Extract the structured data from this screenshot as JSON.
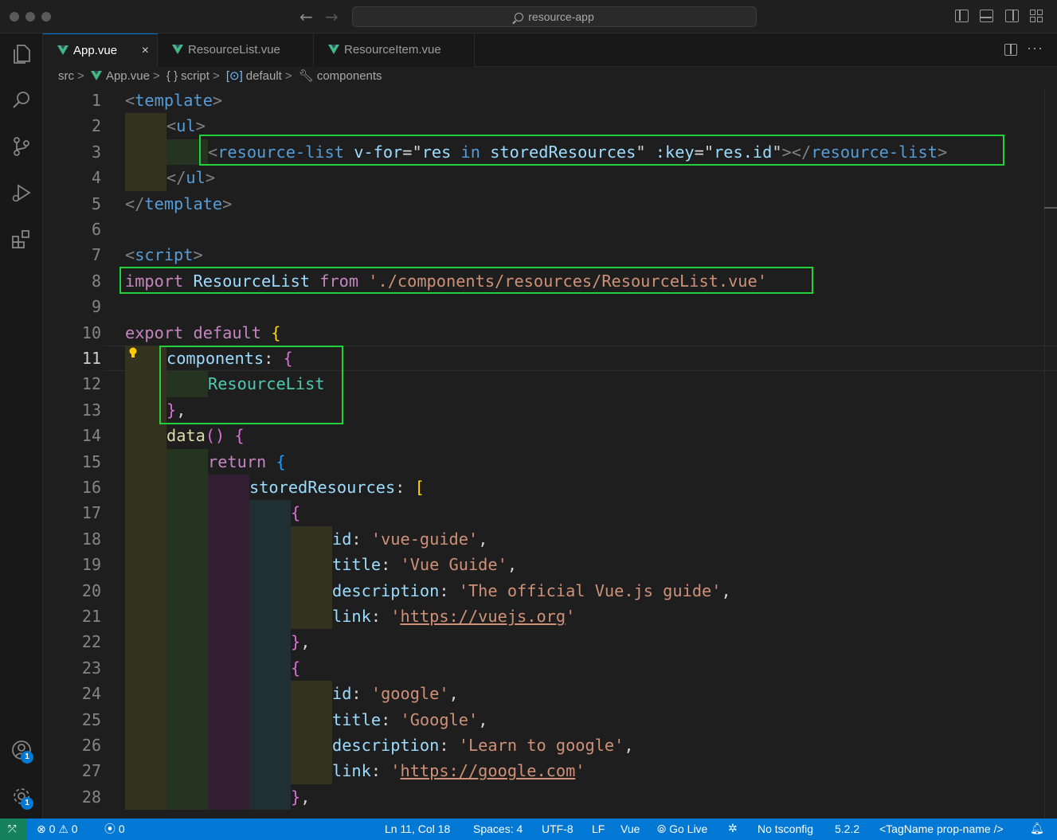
{
  "window": {
    "search_text": "resource-app"
  },
  "tabs": [
    {
      "label": "App.vue",
      "active": true,
      "icon": "vue-icon"
    },
    {
      "label": "ResourceList.vue",
      "active": false,
      "icon": "vue-icon"
    },
    {
      "label": "ResourceItem.vue",
      "active": false,
      "icon": "vue-icon"
    }
  ],
  "tab_close_glyph": "×",
  "more_glyph": "···",
  "breadcrumb": {
    "src": "src",
    "file": "App.vue",
    "script": "script",
    "script_glyph": "{ }",
    "default": "default",
    "components": "components",
    "sep": ">"
  },
  "line_numbers": [
    "1",
    "2",
    "3",
    "4",
    "5",
    "6",
    "7",
    "8",
    "9",
    "10",
    "11",
    "12",
    "13",
    "14",
    "15",
    "16",
    "17",
    "18",
    "19",
    "20",
    "21",
    "22",
    "23",
    "24",
    "25",
    "26",
    "27",
    "28"
  ],
  "current_line": 11,
  "code": {
    "l1_lt": "<",
    "l1_tag": "template",
    "l1_gt": ">",
    "l2_lt": "<",
    "l2_tag": "ul",
    "l2_gt": ">",
    "l3_lt": "<",
    "l3_tag": "resource-list",
    "l3_attr": "v-for",
    "l3_eq": "=",
    "l3_q1": "\"",
    "l3_res": "res",
    "l3_in": "in",
    "l3_stored": "storedResources",
    "l3_q2": "\"",
    "l3_key": ":key",
    "l3_eq2": "=",
    "l3_q3": "\"",
    "l3_resid": "res.id",
    "l3_q4": "\"",
    "l3_close": "></",
    "l3_tag2": "resource-list",
    "l3_gt": ">",
    "l4_lt": "</",
    "l4_tag": "ul",
    "l4_gt": ">",
    "l5_lt": "</",
    "l5_tag": "template",
    "l5_gt": ">",
    "l7_lt": "<",
    "l7_tag": "script",
    "l7_gt": ">",
    "l8_import": "import",
    "l8_name": "ResourceList",
    "l8_from": "from",
    "l8_path": "'./components/resources/ResourceList.vue'",
    "l10_export": "export",
    "l10_default": "default",
    "l10_brace": "{",
    "l11_key": "components",
    "l11_colon": ":",
    "l11_brace": "{",
    "l12_name": "ResourceList",
    "l13_brace": "}",
    "l13_comma": ",",
    "l14_fn": "data",
    "l14_parens": "()",
    "l14_brace": "{",
    "l15_return": "return",
    "l15_brace": "{",
    "l16_key": "storedResources",
    "l16_colon": ":",
    "l16_bracket": "[",
    "l17_brace": "{",
    "l18_key": "id",
    "l18_colon": ":",
    "l18_val": "'vue-guide'",
    "l18_comma": ",",
    "l19_key": "title",
    "l19_colon": ":",
    "l19_val": "'Vue Guide'",
    "l19_comma": ",",
    "l20_key": "description",
    "l20_colon": ":",
    "l20_val": "'The official Vue.js guide'",
    "l20_comma": ",",
    "l21_key": "link",
    "l21_colon": ":",
    "l21_q1": "'",
    "l21_url": "https://vuejs.org",
    "l21_q2": "'",
    "l22_brace": "}",
    "l22_comma": ",",
    "l23_brace": "{",
    "l24_key": "id",
    "l24_colon": ":",
    "l24_val": "'google'",
    "l24_comma": ",",
    "l25_key": "title",
    "l25_colon": ":",
    "l25_val": "'Google'",
    "l25_comma": ",",
    "l26_key": "description",
    "l26_colon": ":",
    "l26_val": "'Learn to google'",
    "l26_comma": ",",
    "l27_key": "link",
    "l27_colon": ":",
    "l27_q1": "'",
    "l27_url": "https://google.com",
    "l27_q2": "'",
    "l28_brace": "}",
    "l28_comma": ","
  },
  "statusbar": {
    "errors": "0",
    "warnings": "0",
    "ports": "0",
    "position": "Ln 11, Col 18",
    "spaces": "Spaces: 4",
    "encoding": "UTF-8",
    "eol": "LF",
    "language": "Vue",
    "go_live": "Go Live",
    "tsconfig": "No tsconfig",
    "version": "5.2.2",
    "tagname": "<TagName prop-name />"
  },
  "badges": {
    "accounts": "1",
    "manage": "1"
  },
  "colors": {
    "accent": "#0078d4",
    "highlight_box": "#22d13a",
    "vue_green": "#42b883"
  }
}
